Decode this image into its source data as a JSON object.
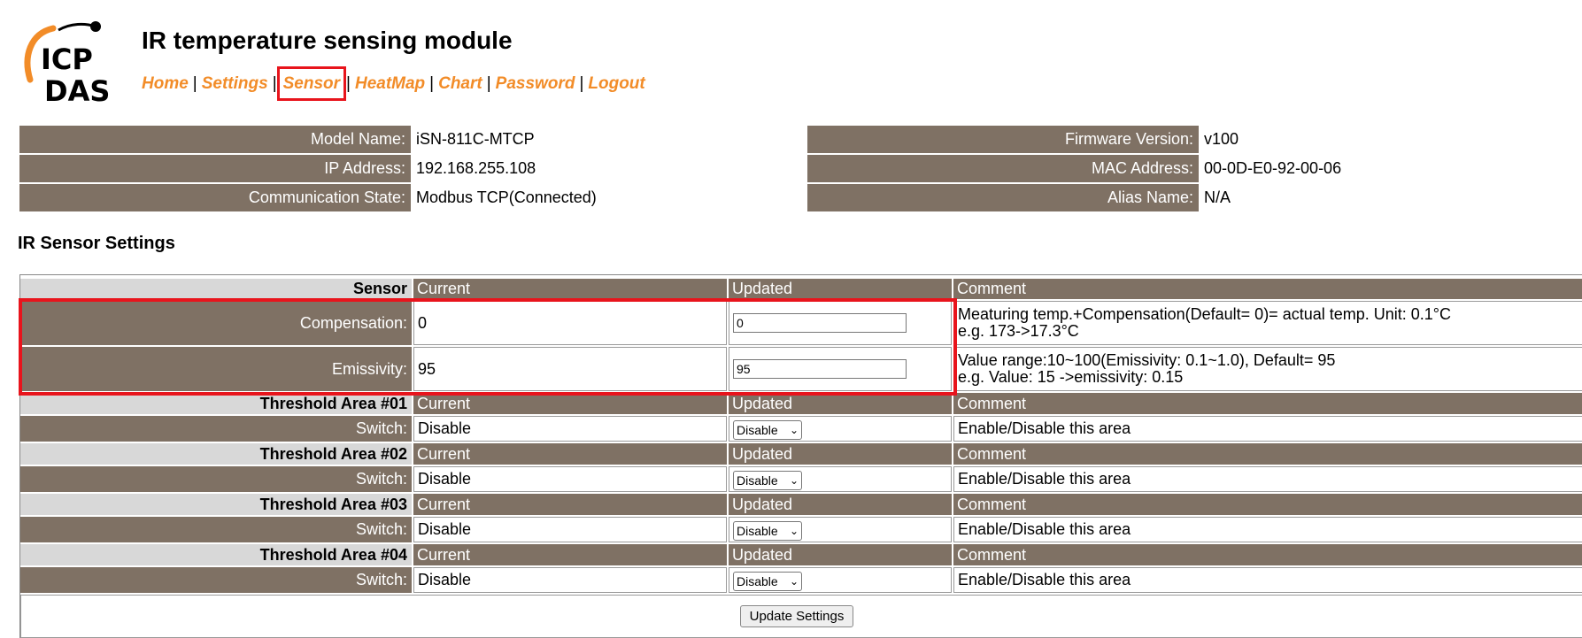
{
  "brand": {
    "logo_line1": "ICP",
    "logo_line2": "DAS"
  },
  "header": {
    "title": "IR temperature sensing module"
  },
  "nav": {
    "items": [
      {
        "label": "Home"
      },
      {
        "label": "Settings"
      },
      {
        "label": "Sensor"
      },
      {
        "label": "HeatMap"
      },
      {
        "label": "Chart"
      },
      {
        "label": "Password"
      },
      {
        "label": "Logout"
      }
    ],
    "separator": "|"
  },
  "info": {
    "model_name_label": "Model Name:",
    "model_name": "iSN-811C-MTCP",
    "ip_label": "IP Address:",
    "ip": "192.168.255.108",
    "comm_label": "Communication State:",
    "comm": "Modbus TCP(Connected)",
    "fw_label": "Firmware Version:",
    "fw": "v100",
    "mac_label": "MAC Address:",
    "mac": "00-0D-E0-92-00-06",
    "alias_label": "Alias Name:",
    "alias": "N/A"
  },
  "section": {
    "title": "IR Sensor Settings"
  },
  "table": {
    "col_current": "Current",
    "col_updated": "Updated",
    "col_comment": "Comment",
    "sensor": {
      "title": "Sensor",
      "compensation_label": "Compensation:",
      "compensation_current": "0",
      "compensation_input": "0",
      "compensation_comment1": "Meaturing temp.+Compensation(Default= 0)= actual temp. Unit: 0.1°C",
      "compensation_comment2": "e.g. 173->17.3°C",
      "emissivity_label": "Emissivity:",
      "emissivity_current": "95",
      "emissivity_input": "95",
      "emissivity_comment1": "Value range:10~100(Emissivity: 0.1~1.0), Default= 95",
      "emissivity_comment2": "e.g. Value: 15 ->emissivity: 0.15"
    },
    "areas": [
      {
        "title": "Threshold Area #01",
        "switch_label": "Switch:",
        "current": "Disable",
        "select": "Disable",
        "comment": "Enable/Disable this area"
      },
      {
        "title": "Threshold Area #02",
        "switch_label": "Switch:",
        "current": "Disable",
        "select": "Disable",
        "comment": "Enable/Disable this area"
      },
      {
        "title": "Threshold Area #03",
        "switch_label": "Switch:",
        "current": "Disable",
        "select": "Disable",
        "comment": "Enable/Disable this area"
      },
      {
        "title": "Threshold Area #04",
        "switch_label": "Switch:",
        "current": "Disable",
        "select": "Disable",
        "comment": "Enable/Disable this area"
      }
    ],
    "update_button": "Update Settings"
  },
  "colors": {
    "header_bg": "#7f7164",
    "nav_link": "#f28c28",
    "highlight": "#e8141c"
  }
}
